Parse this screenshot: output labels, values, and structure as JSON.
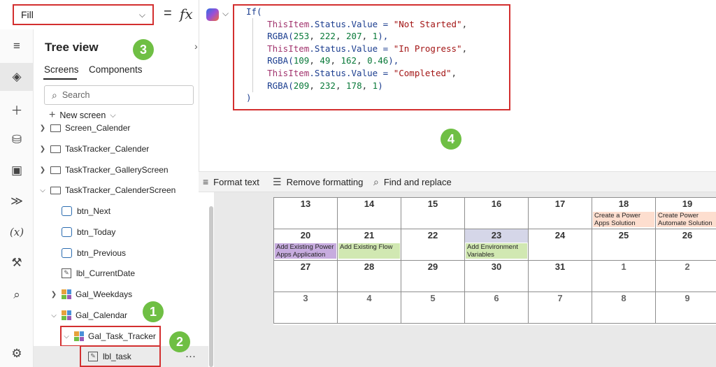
{
  "formula_bar": {
    "property": "Fill",
    "equals": "=",
    "fx": "fx",
    "code": [
      [
        {
          "t": "If(",
          "c": "kw"
        }
      ],
      [
        {
          "t": "    ThisItem",
          "c": "prop"
        },
        {
          "t": ".Status.Value = ",
          "c": "kw"
        },
        {
          "t": "\"Not Started\"",
          "c": "str"
        },
        {
          "t": ",",
          "c": "pl"
        }
      ],
      [
        {
          "t": "    RGBA(",
          "c": "kw"
        },
        {
          "t": "253",
          "c": "num"
        },
        {
          "t": ", ",
          "c": "pl"
        },
        {
          "t": "222",
          "c": "num"
        },
        {
          "t": ", ",
          "c": "pl"
        },
        {
          "t": "207",
          "c": "num"
        },
        {
          "t": ", ",
          "c": "pl"
        },
        {
          "t": "1",
          "c": "num"
        },
        {
          "t": "),",
          "c": "kw"
        }
      ],
      [
        {
          "t": "    ThisItem",
          "c": "prop"
        },
        {
          "t": ".Status.Value = ",
          "c": "kw"
        },
        {
          "t": "\"In Progress\"",
          "c": "str"
        },
        {
          "t": ",",
          "c": "pl"
        }
      ],
      [
        {
          "t": "    RGBA(",
          "c": "kw"
        },
        {
          "t": "109",
          "c": "num"
        },
        {
          "t": ", ",
          "c": "pl"
        },
        {
          "t": "49",
          "c": "num"
        },
        {
          "t": ", ",
          "c": "pl"
        },
        {
          "t": "162",
          "c": "num"
        },
        {
          "t": ", ",
          "c": "pl"
        },
        {
          "t": "0.46",
          "c": "num"
        },
        {
          "t": "),",
          "c": "kw"
        }
      ],
      [
        {
          "t": "    ThisItem",
          "c": "prop"
        },
        {
          "t": ".Status.Value = ",
          "c": "kw"
        },
        {
          "t": "\"Completed\"",
          "c": "str"
        },
        {
          "t": ",",
          "c": "pl"
        }
      ],
      [
        {
          "t": "    RGBA(",
          "c": "kw"
        },
        {
          "t": "209",
          "c": "num"
        },
        {
          "t": ", ",
          "c": "pl"
        },
        {
          "t": "232",
          "c": "num"
        },
        {
          "t": ", ",
          "c": "pl"
        },
        {
          "t": "178",
          "c": "num"
        },
        {
          "t": ", ",
          "c": "pl"
        },
        {
          "t": "1",
          "c": "num"
        },
        {
          "t": ")",
          "c": "kw"
        }
      ],
      [
        {
          "t": ")",
          "c": "kw"
        }
      ]
    ]
  },
  "toolbar": {
    "format_text": "Format text",
    "remove_formatting": "Remove formatting",
    "find_replace": "Find and replace"
  },
  "tree_view": {
    "title": "Tree view",
    "tab_screens": "Screens",
    "tab_components": "Components",
    "search_placeholder": "Search",
    "new_screen": "New screen",
    "nodes": {
      "screen_calender": "Screen_Calender",
      "tasktracker_calender": "TaskTracker_Calender",
      "tasktracker_galleryscreen": "TaskTracker_GalleryScreen",
      "tasktracker_calenderscreen": "TaskTracker_CalenderScreen",
      "btn_next": "btn_Next",
      "btn_today": "btn_Today",
      "btn_previous": "btn_Previous",
      "lbl_currentdate": "lbl_CurrentDate",
      "gal_weekdays": "Gal_Weekdays",
      "gal_calendar": "Gal_Calendar",
      "gal_task_tracker": "Gal_Task_Tracker",
      "lbl_task": "lbl_task",
      "more": "···"
    }
  },
  "badges": {
    "b1": "1",
    "b2": "2",
    "b3": "3",
    "b4": "4"
  },
  "calendar": {
    "rows": [
      [
        {
          "d": "13"
        },
        {
          "d": "14"
        },
        {
          "d": "15"
        },
        {
          "d": "16"
        },
        {
          "d": "17"
        },
        {
          "d": "18",
          "task": "Create a Power Apps Solution",
          "color": "#fddecf"
        },
        {
          "d": "19",
          "task": "Create Power Automate Solution",
          "color": "#fddecf"
        }
      ],
      [
        {
          "d": "20",
          "task": "Add Existing Power Apps Application",
          "color": "#c7acdf"
        },
        {
          "d": "21",
          "task": "Add Existing Flow",
          "color": "#d1e8b2"
        },
        {
          "d": "22"
        },
        {
          "d": "23",
          "task": "Add Environment Variables",
          "color": "#d1e8b2",
          "header": "#d5d6e8"
        },
        {
          "d": "24"
        },
        {
          "d": "25"
        },
        {
          "d": "26"
        }
      ],
      [
        {
          "d": "27"
        },
        {
          "d": "28"
        },
        {
          "d": "29"
        },
        {
          "d": "30"
        },
        {
          "d": "31"
        },
        {
          "d": "1",
          "muted": true
        },
        {
          "d": "2",
          "muted": true
        }
      ],
      [
        {
          "d": "3",
          "muted": true
        },
        {
          "d": "4",
          "muted": true
        },
        {
          "d": "5",
          "muted": true
        },
        {
          "d": "6",
          "muted": true
        },
        {
          "d": "7",
          "muted": true
        },
        {
          "d": "8",
          "muted": true
        },
        {
          "d": "9",
          "muted": true
        }
      ]
    ]
  },
  "colors": {
    "highlight": "#d32f2f",
    "badge": "#6fbf44"
  }
}
